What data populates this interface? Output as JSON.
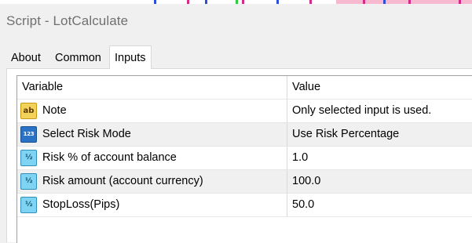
{
  "window": {
    "title": "Script - LotCalculate"
  },
  "tabs": [
    {
      "label": "About",
      "active": false
    },
    {
      "label": "Common",
      "active": false
    },
    {
      "label": "Inputs",
      "active": true
    }
  ],
  "table": {
    "headers": {
      "variable": "Variable",
      "value": "Value"
    },
    "rows": [
      {
        "icon": "text-ab-icon",
        "icon_text": "ab",
        "variable": "Note",
        "value": "Only selected input is used."
      },
      {
        "icon": "enum-123-icon",
        "icon_text": "123",
        "variable": "Select Risk Mode",
        "value": "Use Risk Percentage"
      },
      {
        "icon": "double-half-icon",
        "icon_text": "½",
        "variable": "Risk % of account balance",
        "value": "1.0"
      },
      {
        "icon": "double-half-icon",
        "icon_text": "½",
        "variable": "Risk amount (account currency)",
        "value": "100.0"
      },
      {
        "icon": "double-half-icon",
        "icon_text": "½",
        "variable": "StopLoss(Pips)",
        "value": "50.0"
      }
    ]
  },
  "colors": {
    "icon_text": "#f3d25c",
    "icon_enum": "#2a72c6",
    "icon_double": "#7fd4f4",
    "row_alt": "#f0f0f0"
  }
}
